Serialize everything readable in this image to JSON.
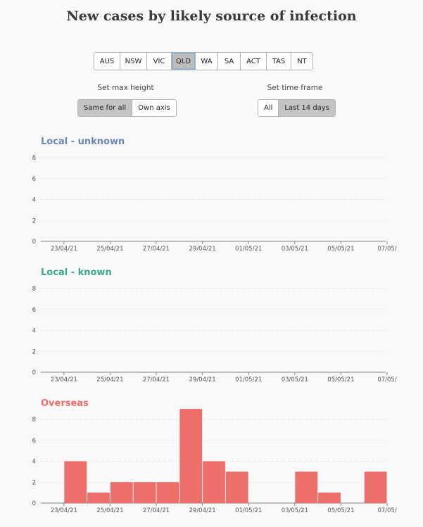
{
  "title": "New cases by likely source of infection",
  "states": {
    "items": [
      "AUS",
      "NSW",
      "VIC",
      "QLD",
      "WA",
      "SA",
      "ACT",
      "TAS",
      "NT"
    ],
    "selected": "QLD"
  },
  "max_height": {
    "label": "Set max height",
    "options": [
      "Same for all",
      "Own axis"
    ],
    "selected": "Same for all"
  },
  "time_frame": {
    "label": "Set time frame",
    "options": [
      "All",
      "Last 14 days"
    ],
    "selected": "Last 14 days"
  },
  "chart_data": [
    {
      "type": "bar",
      "title": "Local - unknown",
      "color": "#6a86b8",
      "x": [
        "22/04/21",
        "23/04/21",
        "24/04/21",
        "25/04/21",
        "26/04/21",
        "27/04/21",
        "28/04/21",
        "29/04/21",
        "30/04/21",
        "01/05/21",
        "02/05/21",
        "03/05/21",
        "04/05/21",
        "05/05/21",
        "06/05/21",
        "07/05/21"
      ],
      "values": [
        0,
        0,
        0,
        0,
        0,
        0,
        0,
        0,
        0,
        0,
        0,
        0,
        0,
        0,
        0,
        0
      ],
      "ylim": [
        0,
        8
      ],
      "yticks": [
        0,
        2,
        4,
        6,
        8
      ],
      "xticks": [
        "23/04/21",
        "25/04/21",
        "27/04/21",
        "29/04/21",
        "01/05/21",
        "03/05/21",
        "05/05/21",
        "07/05/"
      ],
      "grid": true
    },
    {
      "type": "bar",
      "title": "Local - known",
      "color": "#3aaa8e",
      "x": [
        "22/04/21",
        "23/04/21",
        "24/04/21",
        "25/04/21",
        "26/04/21",
        "27/04/21",
        "28/04/21",
        "29/04/21",
        "30/04/21",
        "01/05/21",
        "02/05/21",
        "03/05/21",
        "04/05/21",
        "05/05/21",
        "06/05/21",
        "07/05/21"
      ],
      "values": [
        0,
        0,
        0,
        0,
        0,
        0,
        0,
        0,
        0,
        0,
        0,
        0,
        0,
        0,
        0,
        0
      ],
      "ylim": [
        0,
        8
      ],
      "yticks": [
        0,
        2,
        4,
        6,
        8
      ],
      "xticks": [
        "23/04/21",
        "25/04/21",
        "27/04/21",
        "29/04/21",
        "01/05/21",
        "03/05/21",
        "05/05/21",
        "07/05/"
      ],
      "grid": true
    },
    {
      "type": "bar",
      "title": "Overseas",
      "color": "#ee6e6a",
      "x": [
        "22/04/21",
        "23/04/21",
        "24/04/21",
        "25/04/21",
        "26/04/21",
        "27/04/21",
        "28/04/21",
        "29/04/21",
        "30/04/21",
        "01/05/21",
        "02/05/21",
        "03/05/21",
        "04/05/21",
        "05/05/21",
        "06/05/21",
        "07/05/21"
      ],
      "values": [
        0,
        4,
        1,
        2,
        2,
        2,
        9,
        4,
        3,
        0,
        0,
        3,
        1,
        0,
        3,
        0
      ],
      "ylim": [
        0,
        8
      ],
      "yticks": [
        0,
        2,
        4,
        6,
        8
      ],
      "xticks": [
        "23/04/21",
        "25/04/21",
        "27/04/21",
        "29/04/21",
        "01/05/21",
        "03/05/21",
        "05/05/21",
        "07/05/"
      ],
      "grid": true
    }
  ]
}
